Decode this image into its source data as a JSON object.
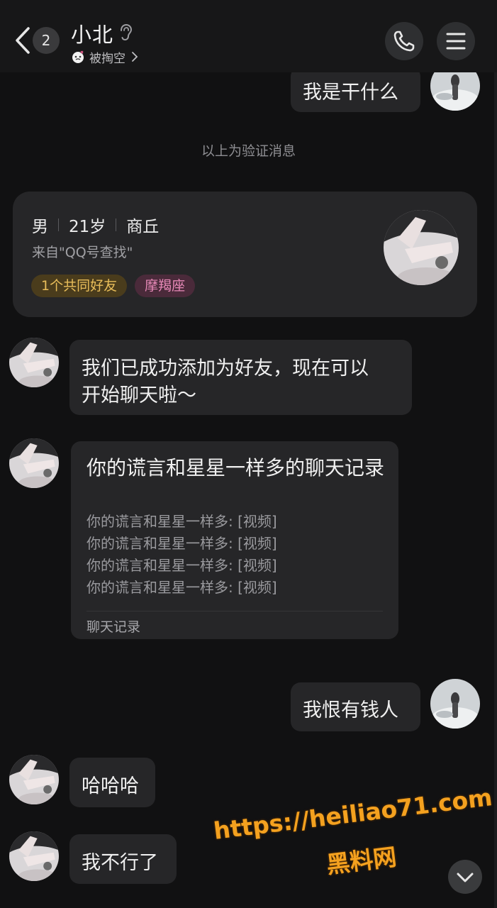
{
  "header": {
    "unread_count": "2",
    "contact_name": "小北",
    "status_text": "被掏空"
  },
  "system_message": "以上为验证消息",
  "profile_card": {
    "gender": "男",
    "age": "21岁",
    "city": "商丘",
    "source": "来自\"QQ号查找\"",
    "tags": [
      "1个共同好友",
      "摩羯座"
    ]
  },
  "messages": {
    "m1": "我是干什么",
    "m2_line1": "我们已成功添加为好友，现在可以",
    "m2_line2": "开始聊天啦～",
    "m4": "我恨有钱人",
    "m5": "哈哈哈",
    "m6": "我不行了"
  },
  "chat_record": {
    "title": "你的谎言和星星一样多的聊天记录",
    "lines": [
      "你的谎言和星星一样多: [视频]",
      "你的谎言和星星一样多: [视频]",
      "你的谎言和星星一样多: [视频]",
      "你的谎言和星星一样多: [视频]"
    ],
    "footer": "聊天记录"
  },
  "watermark": {
    "url": "https://heiliao71.com",
    "name": "黑料网"
  },
  "colors": {
    "background": "#111112",
    "bubble": "#262628",
    "tag_friends_text": "#e8bd5a",
    "tag_zodiac_text": "#e889b8",
    "watermark": "#f4a11f"
  }
}
